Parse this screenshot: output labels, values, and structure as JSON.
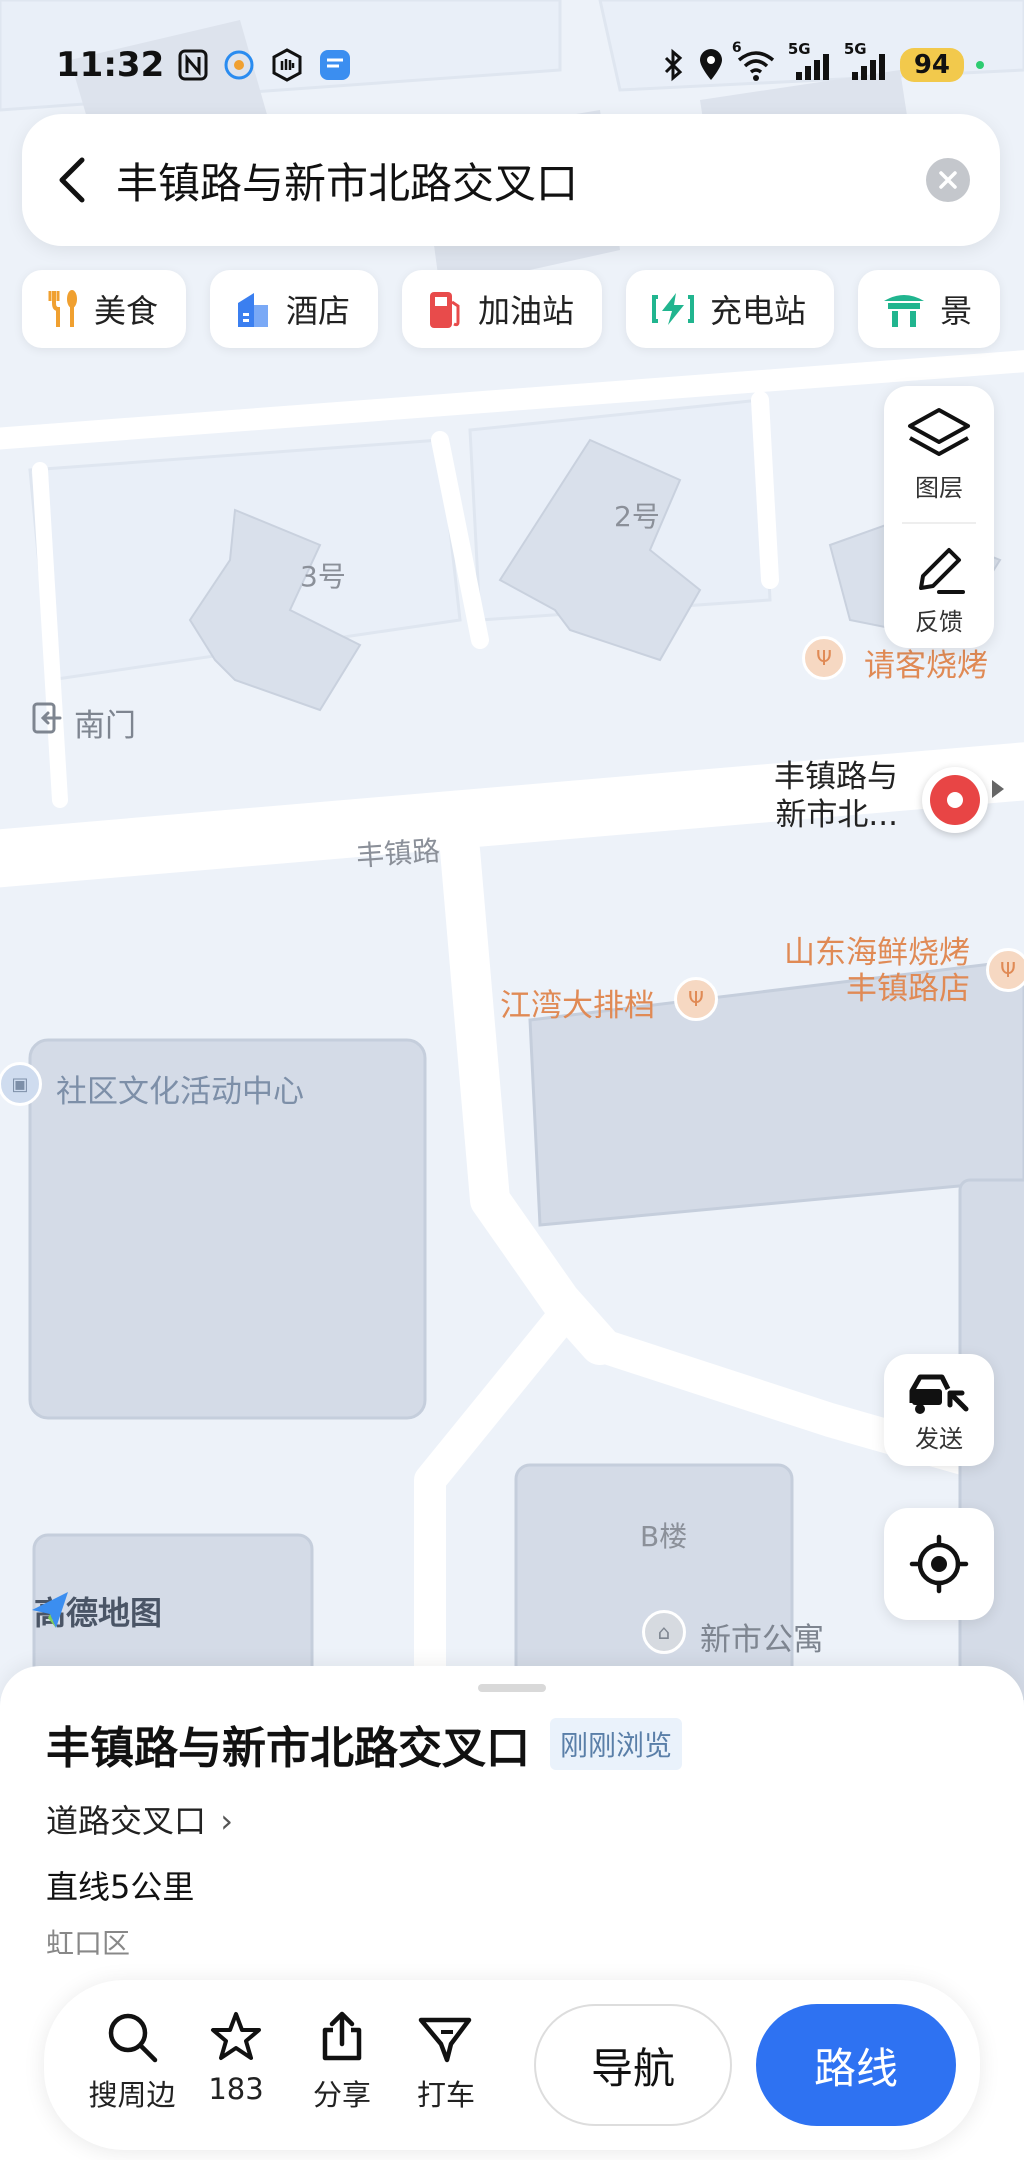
{
  "status_bar": {
    "time": "11:32",
    "battery": "94",
    "network_1": "5G",
    "network_2": "5G",
    "wifi_badge": "6"
  },
  "search": {
    "title": "丰镇路与新市北路交叉口"
  },
  "categories": [
    {
      "label": "美食",
      "icon": "fork-spoon-icon",
      "color": "#f0a030"
    },
    {
      "label": "酒店",
      "icon": "hotel-icon",
      "color": "#3b7ff0"
    },
    {
      "label": "加油站",
      "icon": "gas-station-icon",
      "color": "#e84b4b"
    },
    {
      "label": "充电站",
      "icon": "charging-icon",
      "color": "#21b58f"
    },
    {
      "label": "景",
      "icon": "scenic-icon",
      "color": "#21b58f"
    }
  ],
  "map_tools": {
    "layers_label": "图层",
    "feedback_label": "反馈",
    "send_label": "发送"
  },
  "map": {
    "building_3": "3号",
    "building_2": "2号",
    "south_gate": "南门",
    "road_fengzhen": "丰镇路",
    "marker_label_line1": "丰镇路与",
    "marker_label_line2": "新市北...",
    "poi_restaurant_top": "请客烧烤",
    "poi_seafood_line1": "山东海鲜烧烤",
    "poi_seafood_line2": "丰镇路店",
    "poi_jiangwan": "江湾大排档",
    "poi_community": "社区文化活动中心",
    "building_b": "B楼",
    "poi_apartment": "新市公寓",
    "brand": "高德地图"
  },
  "place": {
    "name": "丰镇路与新市北路交叉口",
    "badge": "刚刚浏览",
    "type": "道路交叉口",
    "distance": "直线5公里",
    "district": "虹口区"
  },
  "actions": {
    "nearby": "搜周边",
    "favorites_count": "183",
    "share": "分享",
    "taxi": "打车",
    "navigate": "导航",
    "route": "路线"
  },
  "colors": {
    "route_button": "#2e72f2",
    "marker": "#e84545",
    "poi_food": "#e08a55"
  }
}
